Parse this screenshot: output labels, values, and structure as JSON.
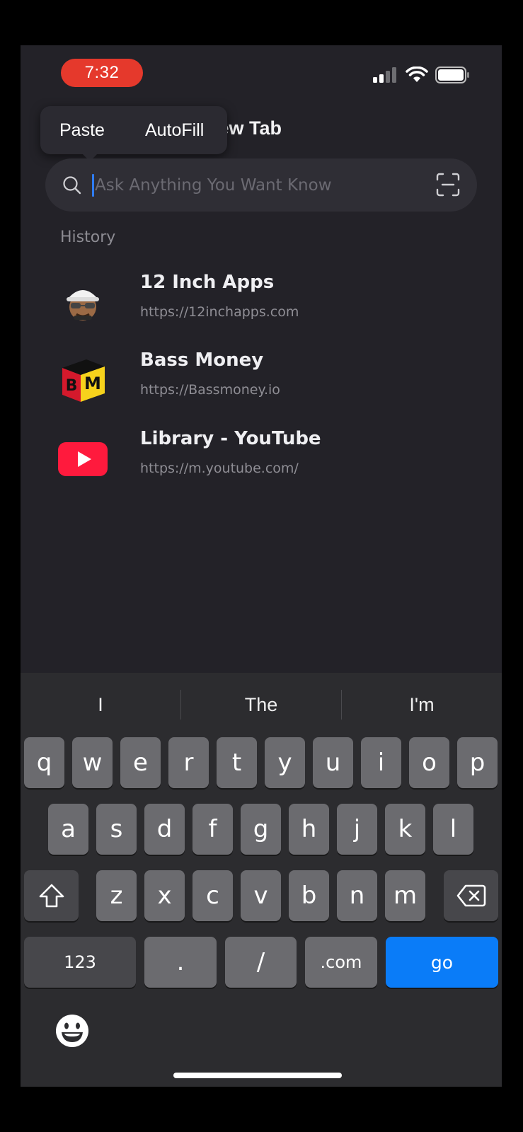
{
  "status_bar": {
    "time": "7:32"
  },
  "context_menu": {
    "paste": "Paste",
    "autofill": "AutoFill"
  },
  "page_title": "New Tab",
  "search": {
    "placeholder": "Ask Anything You Want Know",
    "value": ""
  },
  "history": {
    "label": "History",
    "items": [
      {
        "title": "12 Inch Apps",
        "url": "https://12inchapps.com",
        "icon": "avatar-icon"
      },
      {
        "title": "Bass Money",
        "url": "https://Bassmoney.io",
        "icon": "bm-logo-icon"
      },
      {
        "title": "Library - YouTube",
        "url": "https://m.youtube.com/",
        "icon": "youtube-icon"
      }
    ]
  },
  "keyboard": {
    "suggestions": [
      "I",
      "The",
      "I'm"
    ],
    "row1": [
      "q",
      "w",
      "e",
      "r",
      "t",
      "y",
      "u",
      "i",
      "o",
      "p"
    ],
    "row2": [
      "a",
      "s",
      "d",
      "f",
      "g",
      "h",
      "j",
      "k",
      "l"
    ],
    "row3": [
      "z",
      "x",
      "c",
      "v",
      "b",
      "n",
      "m"
    ],
    "numbers_label": "123",
    "dot_label": ".",
    "slash_label": "/",
    "dotcom_label": ".com",
    "go_label": "go"
  },
  "colors": {
    "accent": "#0a7cf8",
    "time_pill": "#e5392c",
    "background": "#232228"
  }
}
